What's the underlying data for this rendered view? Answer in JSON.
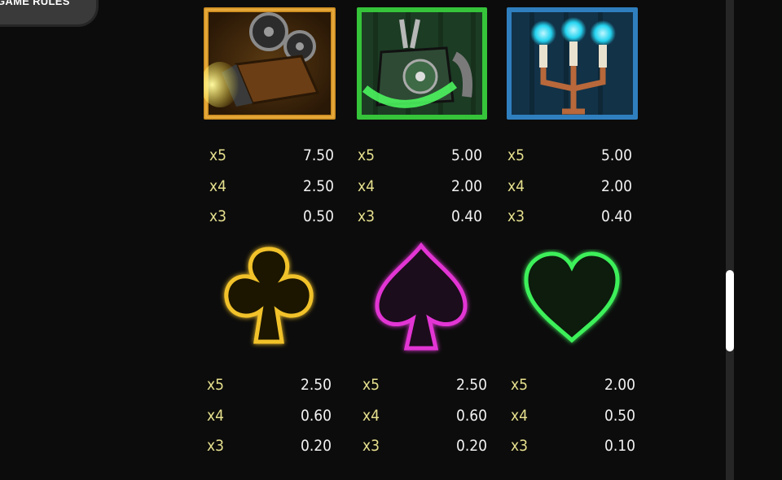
{
  "header": {
    "game_rules_label": "GAME RULES"
  },
  "paytable": {
    "rows": [
      {
        "symbols": [
          {
            "name": "film-camera",
            "icon": "film-projector-camera-icon",
            "frame_color": "#c98a1e",
            "pays": [
              {
                "mult": "x5",
                "value": "7.50"
              },
              {
                "mult": "x4",
                "value": "2.50"
              },
              {
                "mult": "x3",
                "value": "0.50"
              }
            ]
          },
          {
            "name": "telephone",
            "icon": "haunted-telephone-icon",
            "frame_color": "#35c43a",
            "pays": [
              {
                "mult": "x5",
                "value": "5.00"
              },
              {
                "mult": "x4",
                "value": "2.00"
              },
              {
                "mult": "x3",
                "value": "0.40"
              }
            ]
          },
          {
            "name": "candelabra",
            "icon": "candelabra-ghost-flames-icon",
            "frame_color": "#2f7fbf",
            "pays": [
              {
                "mult": "x5",
                "value": "5.00"
              },
              {
                "mult": "x4",
                "value": "2.00"
              },
              {
                "mult": "x3",
                "value": "0.40"
              }
            ]
          }
        ]
      },
      {
        "symbols": [
          {
            "name": "club",
            "icon": "neon-club-icon",
            "color": "#f2c22a",
            "pays": [
              {
                "mult": "x5",
                "value": "2.50"
              },
              {
                "mult": "x4",
                "value": "0.60"
              },
              {
                "mult": "x3",
                "value": "0.20"
              }
            ]
          },
          {
            "name": "spade",
            "icon": "neon-spade-icon",
            "color": "#e234d4",
            "pays": [
              {
                "mult": "x5",
                "value": "2.50"
              },
              {
                "mult": "x4",
                "value": "0.60"
              },
              {
                "mult": "x3",
                "value": "0.20"
              }
            ]
          },
          {
            "name": "heart",
            "icon": "neon-heart-icon",
            "color": "#3ef05a",
            "pays": [
              {
                "mult": "x5",
                "value": "2.00"
              },
              {
                "mult": "x4",
                "value": "0.50"
              },
              {
                "mult": "x3",
                "value": "0.10"
              }
            ]
          }
        ]
      }
    ]
  }
}
